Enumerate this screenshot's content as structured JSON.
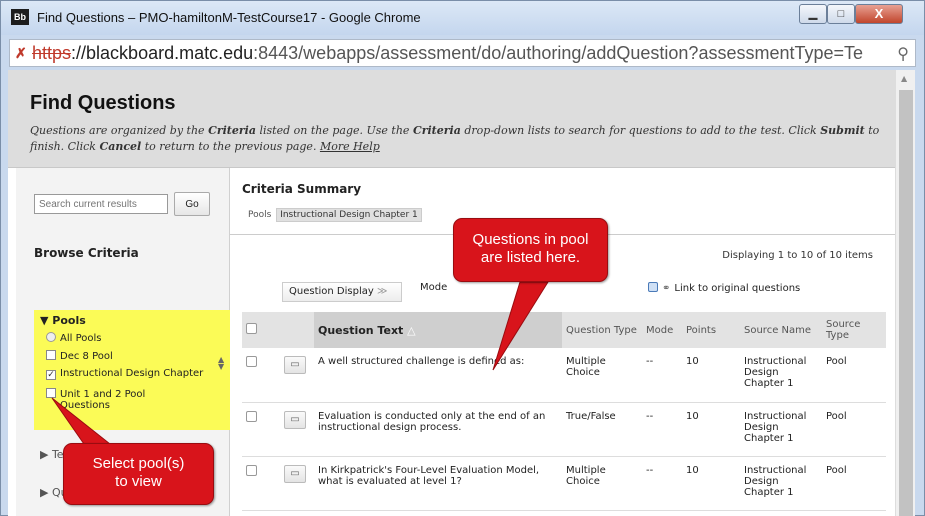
{
  "window": {
    "logo": "Bb",
    "title": "Find Questions – PMO-hamiltonM-TestCourse17 - Google Chrome",
    "min_glyph": "▁",
    "max_glyph": "□",
    "close_glyph": "X"
  },
  "urlbar": {
    "scheme": "https",
    "host": "://blackboard.matc.edu",
    "rest": ":8443/webapps/assessment/do/authoring/addQuestion?assessmentType=Te"
  },
  "header": {
    "title": "Find Questions",
    "desc_1": "Questions are organized by the ",
    "desc_criteria1": "Criteria",
    "desc_2": " listed on the page. Use the ",
    "desc_criteria2": "Criteria",
    "desc_3": " drop-down lists to search for questions to add to the test. Click ",
    "desc_submit": "Submit",
    "desc_4": " to finish. Click ",
    "desc_cancel": "Cancel",
    "desc_5": " to return to the previous page. ",
    "more_help": "More Help"
  },
  "sidebar": {
    "search_placeholder": "Search current results",
    "go_label": "Go",
    "browse_title": "Browse Criteria",
    "pools_head": "▼ Pools",
    "pools": [
      {
        "label": "All Pools",
        "control": "radio"
      },
      {
        "label": "Dec 8 Pool",
        "control": "checkbox",
        "checked": false
      },
      {
        "label": "Instructional Design Chapter",
        "control": "checkbox",
        "checked": true
      },
      {
        "label": "Unit 1 and 2 Pool",
        "control": "checkbox",
        "checked": false
      },
      {
        "label": "Questions",
        "control": "none"
      }
    ],
    "collapsed_1": "▶ Te",
    "collapsed_2": "▶ Qu"
  },
  "main": {
    "criteria_title": "Criteria Summary",
    "pools_label": "Pools",
    "pools_value": "Instructional Design Chapter 1",
    "displaying": "Displaying 1 to 10 of 10 items",
    "question_display": "Question Display",
    "mode_label": "Mode",
    "link_original": "Link to original questions",
    "columns": [
      "Question Text",
      "Question Type",
      "Mode",
      "Points",
      "Source Name",
      "Source Type"
    ],
    "rows": [
      {
        "text": "A well structured challenge is defined as:",
        "type": "Multiple Choice",
        "mode": "--",
        "points": "10",
        "source_name": "Instructional Design Chapter 1",
        "source_type": "Pool"
      },
      {
        "text": "Evaluation is conducted only at the end of an instructional design process.",
        "type": "True/False",
        "mode": "--",
        "points": "10",
        "source_name": "Instructional Design Chapter 1",
        "source_type": "Pool"
      },
      {
        "text": "In Kirkpatrick's Four-Level Evaluation Model, what is evaluated at level 1?",
        "type": "Multiple Choice",
        "mode": "--",
        "points": "10",
        "source_name": "Instructional Design Chapter 1",
        "source_type": "Pool"
      }
    ]
  },
  "callouts": {
    "questions_line1": "Questions in pool",
    "questions_line2": "are listed here.",
    "select_line1": "Select pool(s)",
    "select_line2": "to view"
  },
  "colors": {
    "highlight": "#fbfb57",
    "callout": "#d8141b"
  }
}
